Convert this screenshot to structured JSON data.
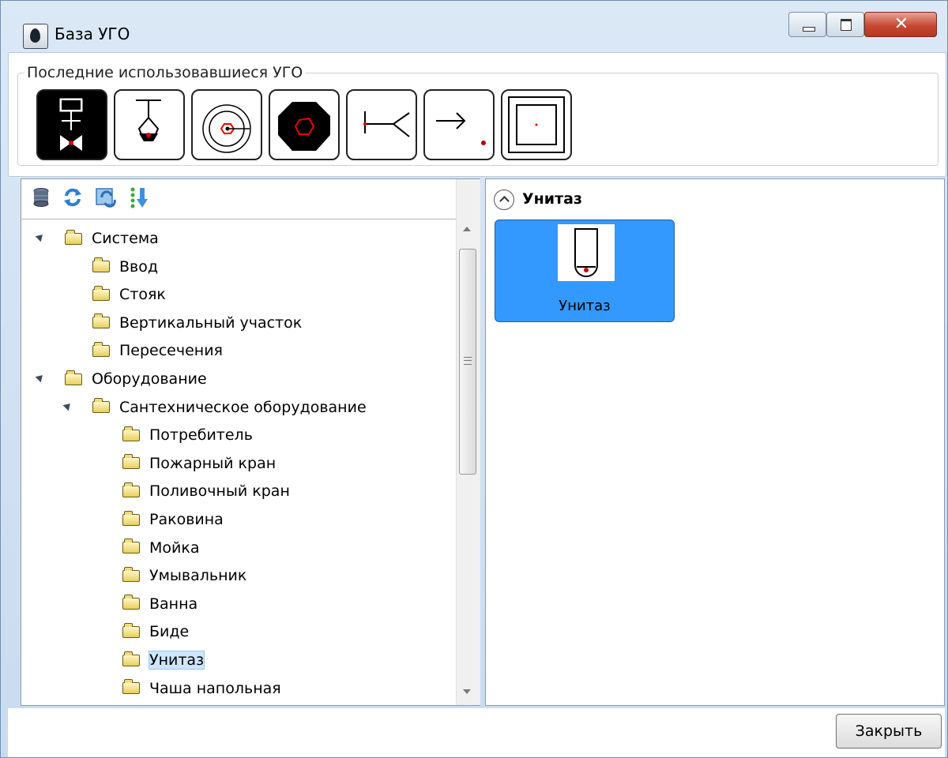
{
  "window": {
    "title": "База УГО"
  },
  "recent": {
    "legend": "Последние использовавшиеся УГО",
    "symbols": [
      "valve-symbol",
      "tap-symbol",
      "circle-target-symbol",
      "filled-octagon-symbol",
      "branch-symbol",
      "arrow-dot-symbol",
      "square-frame-symbol"
    ]
  },
  "toolbar": {
    "icons": [
      "database-icon",
      "refresh-icon",
      "update-icon",
      "sort-icon"
    ]
  },
  "tree": {
    "items": [
      {
        "label": "Система",
        "level": 0,
        "expanded": true
      },
      {
        "label": "Ввод",
        "level": 1
      },
      {
        "label": "Стояк",
        "level": 1
      },
      {
        "label": "Вертикальный участок",
        "level": 1
      },
      {
        "label": "Пересечения",
        "level": 1
      },
      {
        "label": "Оборудование",
        "level": 0,
        "expanded": true
      },
      {
        "label": "Сантехническое оборудование",
        "level": 1,
        "expanded": true
      },
      {
        "label": "Потребитель",
        "level": 2
      },
      {
        "label": "Пожарный кран",
        "level": 2
      },
      {
        "label": "Поливочный кран",
        "level": 2
      },
      {
        "label": "Раковина",
        "level": 2
      },
      {
        "label": "Мойка",
        "level": 2
      },
      {
        "label": "Умывальник",
        "level": 2
      },
      {
        "label": "Ванна",
        "level": 2
      },
      {
        "label": "Биде",
        "level": 2
      },
      {
        "label": "Унитаз",
        "level": 2,
        "selected": true
      },
      {
        "label": "Чаша напольная",
        "level": 2
      }
    ]
  },
  "gallery": {
    "group_title": "Унитаз",
    "item_label": "Унитаз"
  },
  "buttons": {
    "close_label": "Закрыть"
  },
  "colors": {
    "selection": "#3399ff",
    "tree_selection": "#cde6fc"
  }
}
